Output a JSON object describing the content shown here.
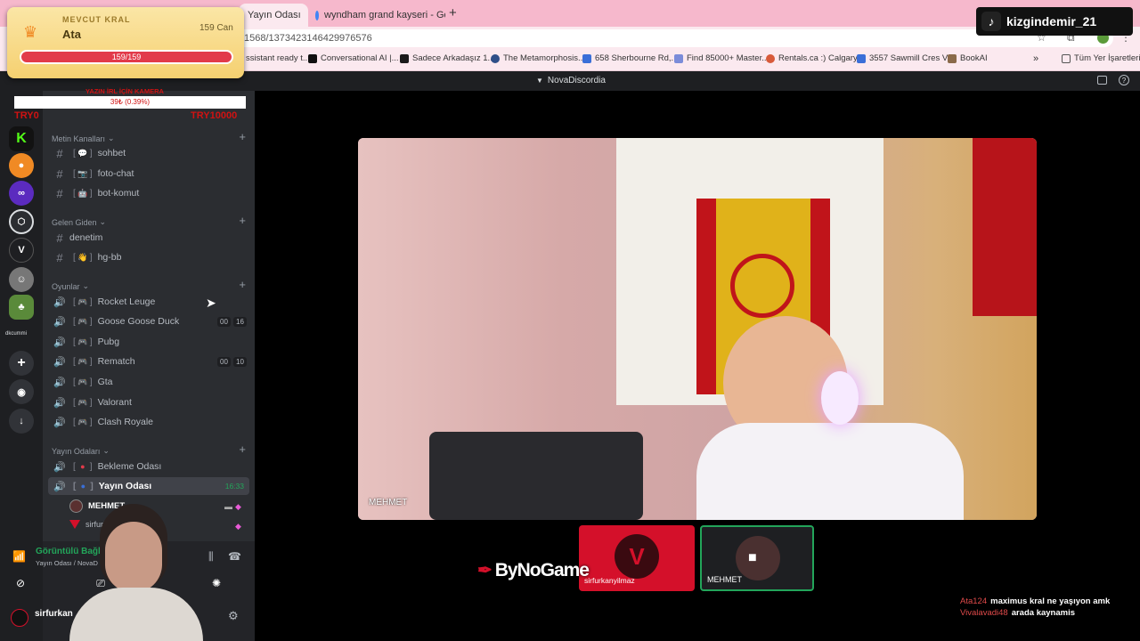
{
  "browser": {
    "tabs": [
      {
        "label": "Yayın Odası"
      },
      {
        "label": "wyndham grand kayseri - Goog"
      }
    ],
    "new_tab": "+",
    "url": "1568/1373423146429976576",
    "bookmarks": [
      {
        "label": "ssistant ready t...",
        "color": "#f0c24b"
      },
      {
        "label": "Conversational AI |...",
        "color": "#111111"
      },
      {
        "label": "Sadece Arkadaşız 1...",
        "color": "#1b1b1b"
      },
      {
        "label": "The Metamorphosis...",
        "color": "#2f4f88"
      },
      {
        "label": "658 Sherbourne Rd,...",
        "color": "#3a6fd8"
      },
      {
        "label": "Find 85000+ Master...",
        "color": "#7b8cd9"
      },
      {
        "label": "Rentals.ca :) Calgary...",
        "color": "#d85a3a"
      },
      {
        "label": "3557 Sawmill Cres V...",
        "color": "#3a6fd8"
      },
      {
        "label": "BookAI",
        "color": "#8a6a4a"
      }
    ],
    "bookmarks_more": "»",
    "all_bookmarks": "Tüm Yer İşaretleri"
  },
  "discord": {
    "server_title": "NovaDiscordia",
    "rail_label": "dkcummi",
    "categories": {
      "text": "Metin Kanalları",
      "incoming": "Gelen Giden",
      "games": "Oyunlar",
      "stream": "Yayın Odaları"
    },
    "text_channels": [
      {
        "emoji": "💬",
        "name": "sohbet"
      },
      {
        "emoji": "📷",
        "name": "foto-chat"
      },
      {
        "emoji": "🤖",
        "name": "bot-komut"
      }
    ],
    "incoming_channels": [
      {
        "name": "denetim"
      },
      {
        "emoji": "👋",
        "name": "hg-bb"
      }
    ],
    "game_channels": [
      {
        "name": "Rocket Leuge"
      },
      {
        "name": "Goose Goose Duck",
        "badge1": "00",
        "badge2": "16"
      },
      {
        "name": "Pubg"
      },
      {
        "name": "Rematch",
        "badge1": "00",
        "badge2": "10"
      },
      {
        "name": "Gta"
      },
      {
        "name": "Valorant"
      },
      {
        "name": "Clash Royale"
      }
    ],
    "stream_channels": [
      {
        "name": "Bekleme Odası"
      },
      {
        "name": "Yayın Odası",
        "time": "16:33"
      }
    ],
    "voice_users": [
      {
        "name": "MEHMET"
      },
      {
        "name": "sirfurka"
      }
    ],
    "voice_status": {
      "title": "Görüntülü Bağlantı",
      "subtitle": "Yayın Odası / NovaD"
    },
    "user_panel": {
      "name": "sirfurkan"
    },
    "video_label": "MEHMET",
    "tiles": [
      {
        "name": "sirfurkanyilmaz"
      },
      {
        "name": "MEHMET"
      }
    ]
  },
  "overlay": {
    "tiktok_user": "kizgindemir_21",
    "king": {
      "title": "MEVCUT KRAL",
      "name": "Ata",
      "amount": "159 Can",
      "bar": "159/159",
      "progress": 1.0
    },
    "donation": {
      "header": "YAZIN İRL İÇİN KAMERA",
      "value": "39₺ (0.39%)",
      "min": "TRY0",
      "max": "TRY10000"
    },
    "brand": "ByNoGame",
    "chat": [
      {
        "user": "Ata124",
        "text": "maximus kral ne yaşıyon amk"
      },
      {
        "user": "Vivalavadi48",
        "text": "arada kaynamis"
      }
    ]
  },
  "colors": {
    "accent_green": "#23a55a",
    "donation_red": "#d01212",
    "tile_red": "#d4102a"
  }
}
